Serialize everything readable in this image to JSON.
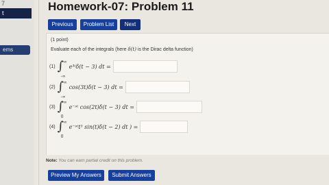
{
  "sidebar": {
    "number": "7",
    "box": "t",
    "item": "ems"
  },
  "page_title": "Homework-07: Problem 11",
  "nav": {
    "previous": "Previous",
    "problem_list": "Problem List",
    "next": "Next"
  },
  "problem": {
    "points": "(1 point)",
    "prompt_pre": "Evaluate each of the integrals (here ",
    "prompt_math": "δ(t)",
    "prompt_post": " is the Dirac delta function)",
    "items": [
      {
        "num": "(1)",
        "upper": "∞",
        "lower": "-∞",
        "expr": "e³ᵗδ(t − 3) dt =",
        "ans": ""
      },
      {
        "num": "(2)",
        "upper": "∞",
        "lower": "-∞",
        "expr": "cos(3t)δ(t − 3) dt =",
        "ans": ""
      },
      {
        "num": "(3)",
        "upper": "∞",
        "lower": "0",
        "expr": "e⁻ˢᵗ cos(2t)δ(t − 3) dt =",
        "ans": ""
      },
      {
        "num": "(4)",
        "upper": "∞",
        "lower": "0",
        "expr": "e⁻ˢᵗt³ sin(t)δ(t − 2) dt ) =",
        "ans": ""
      }
    ]
  },
  "note": {
    "label": "Note:",
    "text": " You can earn partial credit on this problem."
  },
  "actions": {
    "preview": "Preview My Answers",
    "submit": "Submit Answers"
  },
  "colors": {
    "button": "#173f9c",
    "sidebar_dark": "#142446"
  }
}
